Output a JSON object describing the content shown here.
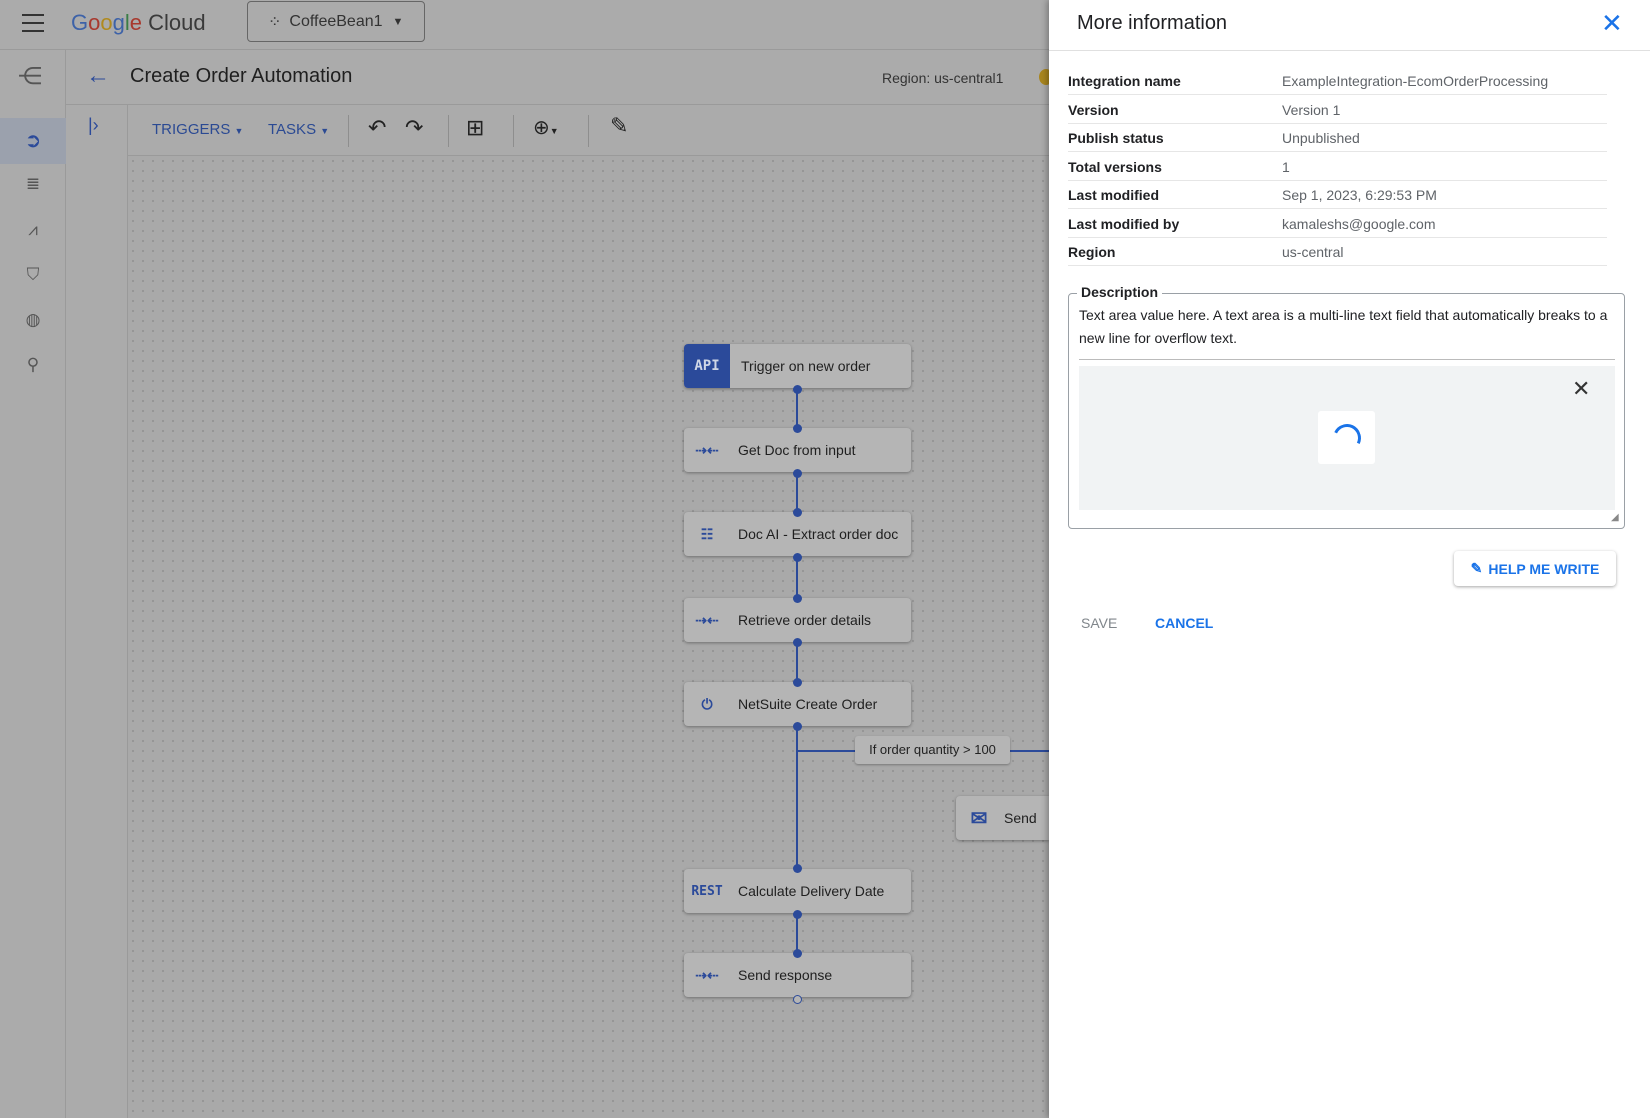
{
  "topbar": {
    "brand": "Google Cloud",
    "project": "CoffeeBean1"
  },
  "header": {
    "title": "Create Order Automation",
    "region": "Region: us-central1"
  },
  "toolbar": {
    "triggers": "TRIGGERS",
    "tasks": "TASKS"
  },
  "flow": {
    "nodes": [
      {
        "icon": "API",
        "label": "Trigger on new order"
      },
      {
        "icon": "data-mapping-icon",
        "label": "Get Doc from input"
      },
      {
        "icon": "doc-ai-icon",
        "label": "Doc AI - Extract order doc"
      },
      {
        "icon": "data-mapping-icon",
        "label": "Retrieve order details"
      },
      {
        "icon": "connector-icon",
        "label": "NetSuite Create Order"
      },
      {
        "icon": "REST",
        "label": "Calculate Delivery Date"
      },
      {
        "icon": "data-mapping-icon",
        "label": "Send response"
      }
    ],
    "branch_label": "If order quantity > 100",
    "side_node": "Send"
  },
  "panel": {
    "title": "More information",
    "rows": [
      {
        "k": "Integration name",
        "v": "ExampleIntegration-EcomOrderProcessing"
      },
      {
        "k": "Version",
        "v": "Version 1"
      },
      {
        "k": "Publish status",
        "v": "Unpublished"
      },
      {
        "k": "Total versions",
        "v": "1"
      },
      {
        "k": "Last modified",
        "v": "Sep 1, 2023, 6:29:53 PM"
      },
      {
        "k": "Last modified by",
        "v": "kamaleshs@google.com"
      },
      {
        "k": "Region",
        "v": "us-central"
      }
    ],
    "description_label": "Description",
    "description": "Text area value here. A text area is a multi-line text field that automatically breaks to a new line for overflow text.",
    "help_me_write": "HELP ME WRITE",
    "save": "SAVE",
    "cancel": "CANCEL"
  },
  "colors": {
    "accent": "#1a73e8",
    "dim_accent": "#2b4a9a"
  }
}
